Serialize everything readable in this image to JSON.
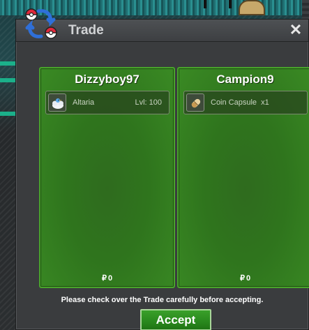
{
  "window": {
    "title": "Trade",
    "close_label": "✕"
  },
  "left_trader": {
    "name": "Dizzyboy97",
    "items": [
      {
        "name": "Altaria",
        "level": "Lvl: 100",
        "icon": "altaria-pokemon-icon"
      }
    ],
    "money_symbol": "₽",
    "money": "0"
  },
  "right_trader": {
    "name": "Campion9",
    "items": [
      {
        "name": "Coin Capsule",
        "quantity": "x1",
        "icon": "coin-capsule-icon"
      }
    ],
    "money_symbol": "₽",
    "money": "0"
  },
  "footer": {
    "note": "Please check over the Trade carefully before accepting.",
    "accept_label": "Accept"
  },
  "colors": {
    "panel_green": "#2f751d",
    "accept_green": "#2a8a1e",
    "titlebar": "#4e5154"
  }
}
